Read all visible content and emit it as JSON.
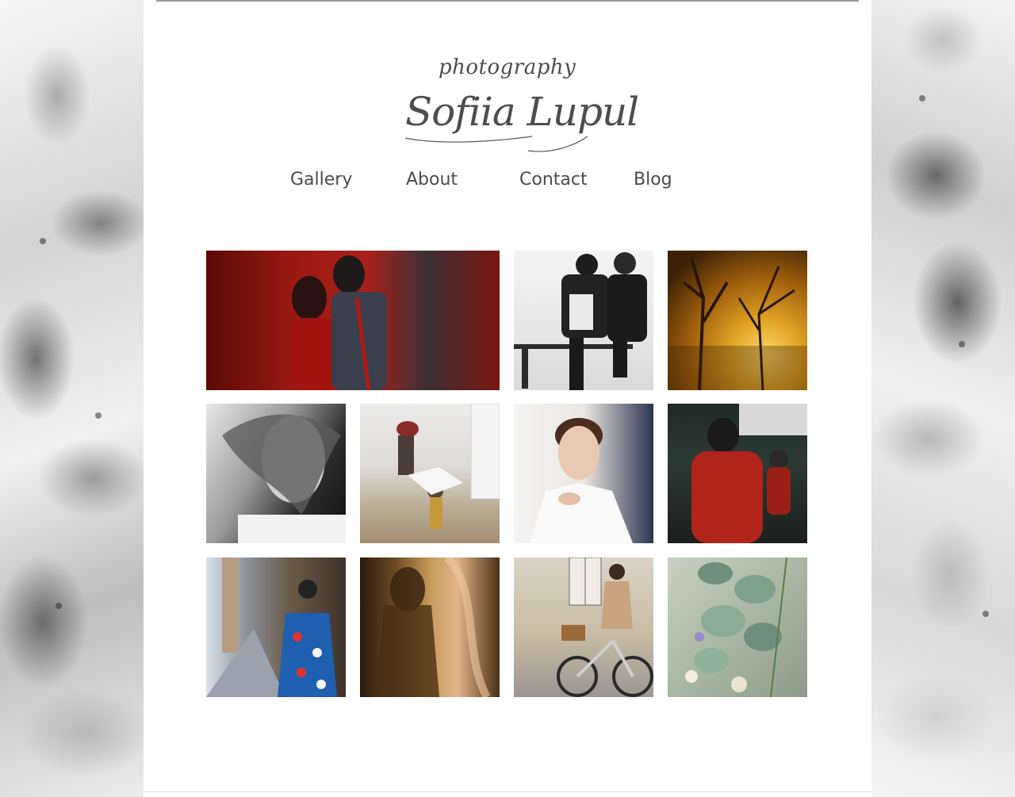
{
  "logo": {
    "subtitle": "photography",
    "name": "Sofiia Lupul"
  },
  "nav": {
    "items": [
      {
        "label": "Gallery"
      },
      {
        "label": "About"
      },
      {
        "label": "Contact"
      },
      {
        "label": "Blog"
      }
    ]
  },
  "gallery": {
    "photos": [
      {
        "subject": "couple-red-wall"
      },
      {
        "subject": "two-men-bench-bw"
      },
      {
        "subject": "golden-trees-sunlight"
      },
      {
        "subject": "woman-windblown-hair-bw"
      },
      {
        "subject": "children-jumping-street"
      },
      {
        "subject": "woman-portrait-white-robe"
      },
      {
        "subject": "dancers-red-shirt"
      },
      {
        "subject": "street-blue-patterned-coat"
      },
      {
        "subject": "woman-amber-fabric"
      },
      {
        "subject": "woman-bicycle-street"
      },
      {
        "subject": "eucalyptus-flowers"
      }
    ]
  }
}
